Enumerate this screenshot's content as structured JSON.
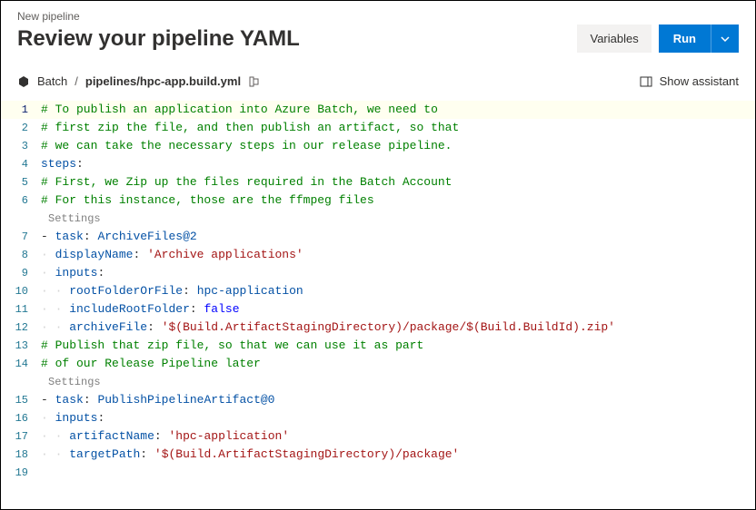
{
  "header": {
    "breadcrumb": "New pipeline",
    "title": "Review your pipeline YAML",
    "variables_label": "Variables",
    "run_label": "Run"
  },
  "subheader": {
    "repo_name": "Batch",
    "separator": "/",
    "file_path": "pipelines/hpc-app.build.yml",
    "assistant_label": "Show assistant"
  },
  "editor": {
    "settings_label": "Settings",
    "lines": [
      {
        "n": 1,
        "type": "comment",
        "text": "# To publish an application into Azure Batch, we need to"
      },
      {
        "n": 2,
        "type": "comment",
        "text": "# first zip the file, and then publish an artifact, so that"
      },
      {
        "n": 3,
        "type": "comment",
        "text": "# we can take the necessary steps in our release pipeline."
      },
      {
        "n": 4,
        "type": "key",
        "indent": 0,
        "key": "steps",
        "val": ""
      },
      {
        "n": 5,
        "type": "comment",
        "text": "# First, we Zip up the files required in the Batch Account"
      },
      {
        "n": 6,
        "type": "comment",
        "text": "# For this instance, those are the ffmpeg files"
      },
      {
        "type": "settings"
      },
      {
        "n": 7,
        "type": "listkey",
        "indent": 0,
        "key": "task",
        "val": "ArchiveFiles@2"
      },
      {
        "n": 8,
        "type": "key",
        "indent": 1,
        "key": "displayName",
        "val_str": "'Archive applications'"
      },
      {
        "n": 9,
        "type": "key",
        "indent": 1,
        "key": "inputs",
        "val": ""
      },
      {
        "n": 10,
        "type": "key",
        "indent": 2,
        "key": "rootFolderOrFile",
        "val": "hpc-application"
      },
      {
        "n": 11,
        "type": "key",
        "indent": 2,
        "key": "includeRootFolder",
        "val_bool": "false"
      },
      {
        "n": 12,
        "type": "key",
        "indent": 2,
        "key": "archiveFile",
        "val_str": "'$(Build.ArtifactStagingDirectory)/package/$(Build.BuildId).zip'"
      },
      {
        "n": 13,
        "type": "comment",
        "text": "# Publish that zip file, so that we can use it as part"
      },
      {
        "n": 14,
        "type": "comment",
        "text": "# of our Release Pipeline later"
      },
      {
        "type": "settings"
      },
      {
        "n": 15,
        "type": "listkey",
        "indent": 0,
        "key": "task",
        "val": "PublishPipelineArtifact@0"
      },
      {
        "n": 16,
        "type": "key",
        "indent": 1,
        "key": "inputs",
        "val": ""
      },
      {
        "n": 17,
        "type": "key",
        "indent": 2,
        "key": "artifactName",
        "val_str": "'hpc-application'"
      },
      {
        "n": 18,
        "type": "key",
        "indent": 2,
        "key": "targetPath",
        "val_str": "'$(Build.ArtifactStagingDirectory)/package'"
      },
      {
        "n": 19,
        "type": "empty"
      }
    ]
  }
}
